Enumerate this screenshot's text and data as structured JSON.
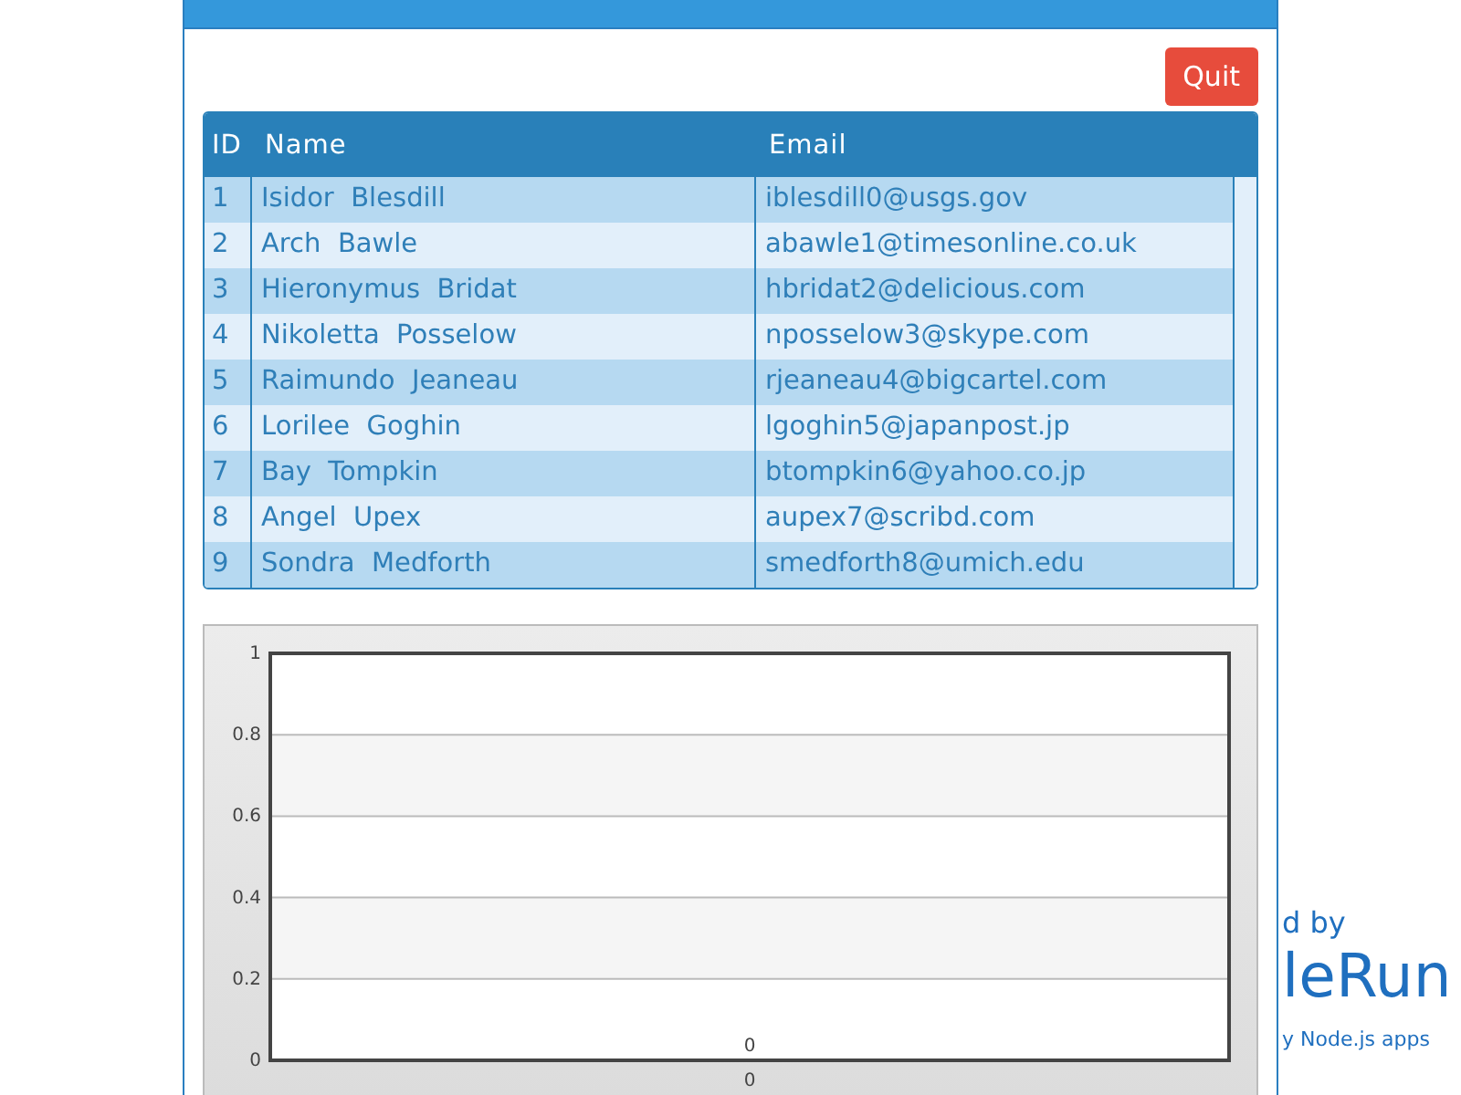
{
  "quit_button": {
    "label": "Quit"
  },
  "table": {
    "columns": [
      "ID",
      "Name",
      "Email"
    ],
    "rows": [
      {
        "id": "1",
        "first_name": "Isidor",
        "last_name": "Blesdill",
        "email": "iblesdill0@usgs.gov"
      },
      {
        "id": "2",
        "first_name": "Arch",
        "last_name": "Bawle",
        "email": "abawle1@timesonline.co.uk"
      },
      {
        "id": "3",
        "first_name": "Hieronymus",
        "last_name": "Bridat",
        "email": "hbridat2@delicious.com"
      },
      {
        "id": "4",
        "first_name": "Nikoletta",
        "last_name": "Posselow",
        "email": "nposselow3@skype.com"
      },
      {
        "id": "5",
        "first_name": "Raimundo",
        "last_name": "Jeaneau",
        "email": "rjeaneau4@bigcartel.com"
      },
      {
        "id": "6",
        "first_name": "Lorilee",
        "last_name": "Goghin",
        "email": "lgoghin5@japanpost.jp"
      },
      {
        "id": "7",
        "first_name": "Bay",
        "last_name": "Tompkin",
        "email": "btompkin6@yahoo.co.jp"
      },
      {
        "id": "8",
        "first_name": "Angel",
        "last_name": "Upex",
        "email": "aupex7@scribd.com"
      },
      {
        "id": "9",
        "first_name": "Sondra",
        "last_name": "Medforth",
        "email": "smedforth8@umich.edu"
      }
    ]
  },
  "chart": {
    "chart_data": {
      "type": "bar",
      "categories": [
        "0"
      ],
      "values": [
        0
      ],
      "ylim": [
        0,
        1
      ],
      "yticks": [
        0,
        0.2,
        0.4,
        0.6,
        0.8,
        1
      ],
      "data_labels": true,
      "grid": true
    }
  },
  "background_promo": {
    "line_1": "d by",
    "line_2": "leRun",
    "line_3": "y Node.js apps"
  }
}
